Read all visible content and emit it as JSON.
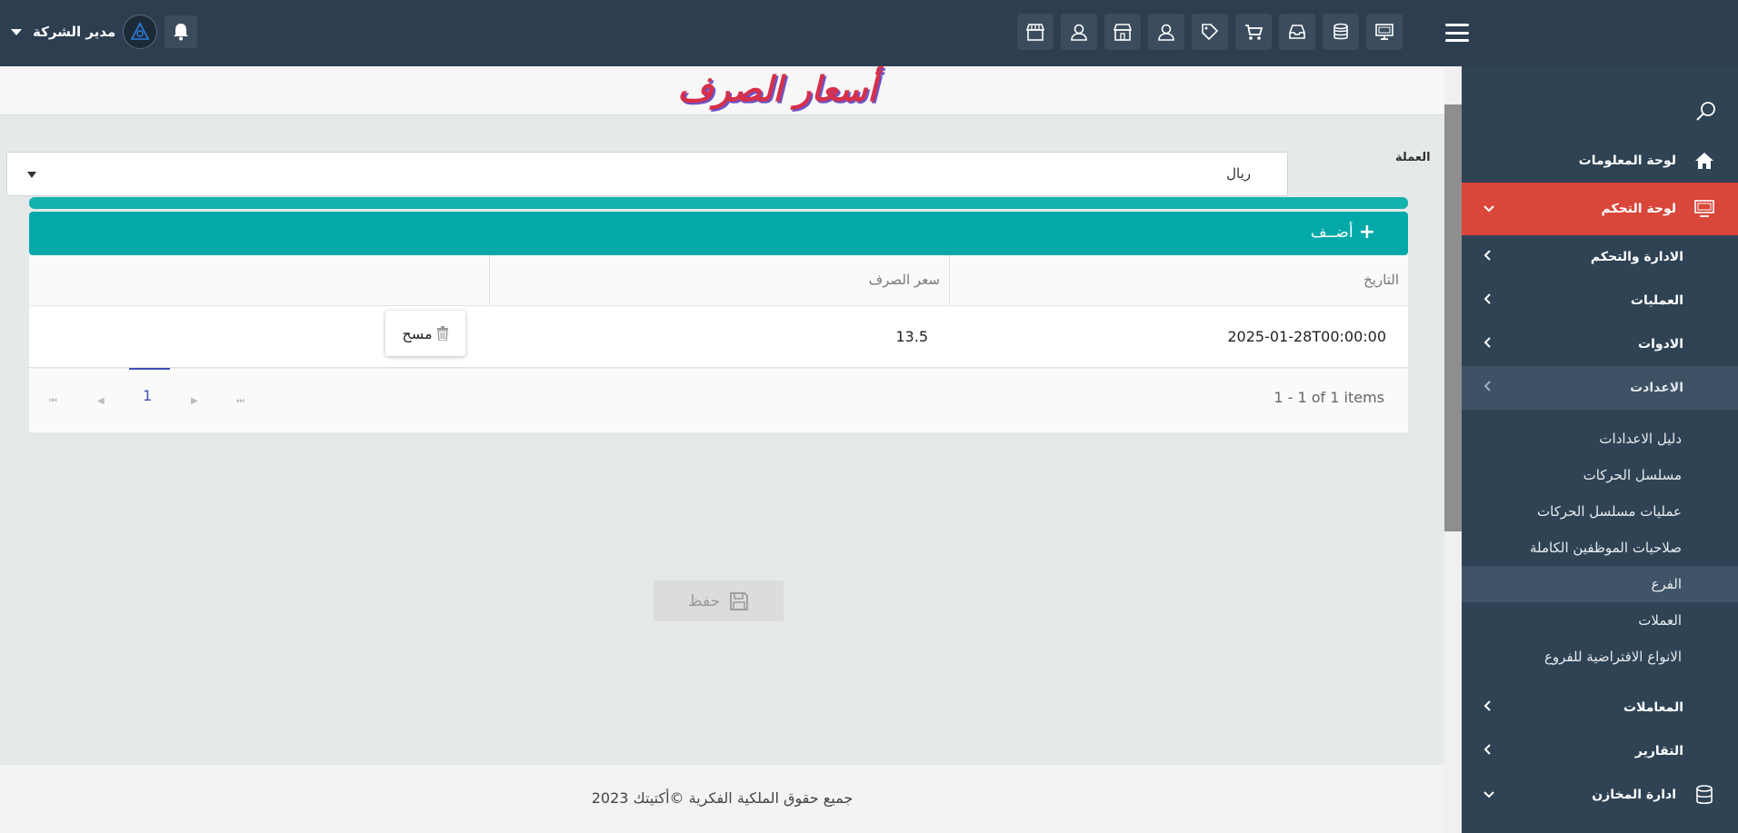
{
  "topbar": {
    "user_name": "مدير الشركة",
    "icons": [
      "store-icon",
      "user-icon",
      "store-icon",
      "user-icon",
      "tag-icon",
      "cart-icon",
      "inbox-icon",
      "database-icon",
      "monitor-icon"
    ]
  },
  "sidebar": {
    "items": [
      {
        "label": "لوحة المعلومات"
      },
      {
        "label": "لوحة التحكم"
      },
      {
        "label": "الادارة والتحكم"
      },
      {
        "label": "العمليات"
      },
      {
        "label": "الادوات"
      },
      {
        "label": "الاعدادت"
      }
    ],
    "submenu": [
      "دليل الاعدادات",
      "مسلسل الحركات",
      "عمليات مسلسل الحركات",
      "صلاحيات الموظفين الكاملة",
      "الفرع",
      "العملات",
      "الانواع الافتراضية للفروع"
    ],
    "bottom_items": [
      {
        "label": "المعاملات"
      },
      {
        "label": "التقارير"
      },
      {
        "label": "ادارة المخازن"
      }
    ]
  },
  "page": {
    "title": "أسعار الصرف",
    "currency_label": "العملة",
    "currency_value": "ريال"
  },
  "grid": {
    "add_label": "أضــف",
    "columns": [
      "التاريخ",
      "سعر الصرف",
      ""
    ],
    "rows": [
      {
        "date": "2025-01-28T00:00:00",
        "rate": "13.5",
        "delete_label": "مسح"
      }
    ],
    "pager": {
      "current_page": "1",
      "info": "1 - 1 of 1 items"
    }
  },
  "actions": {
    "save_label": "حفظ"
  },
  "footer": {
    "text": "جميع حقوق الملكية الفكرية ©أكتيتك 2023"
  }
}
